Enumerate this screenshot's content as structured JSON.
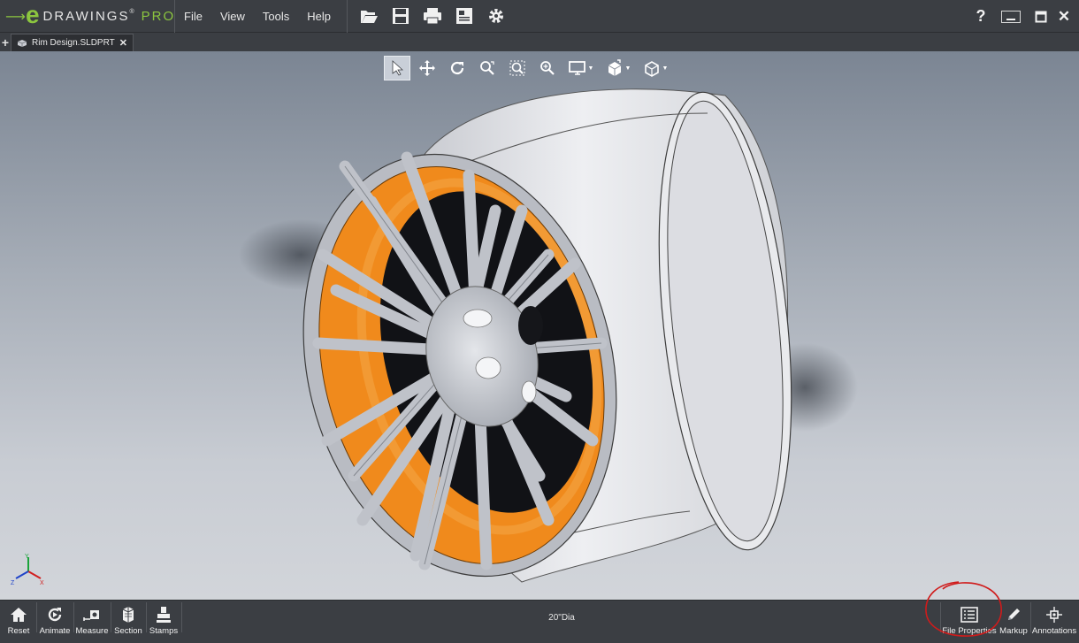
{
  "app": {
    "logo": {
      "e_letter": "e",
      "name": "DRAWINGS",
      "trademark": "®",
      "edition": "PRO"
    },
    "menu": [
      "File",
      "View",
      "Tools",
      "Help"
    ],
    "quick_access_icons": [
      "open-icon",
      "save-icon",
      "print-icon",
      "publish-icon",
      "settings-icon"
    ],
    "window_controls": {
      "help": "?",
      "close": "✕"
    },
    "accent_color": "#8cc63f"
  },
  "tabs": {
    "add_label": "+",
    "items": [
      {
        "label": "Rim Design.SLDPRT",
        "close": "✕"
      }
    ]
  },
  "view_toolbar": {
    "tools": [
      "select-icon",
      "pan-icon",
      "rotate-icon",
      "zoom-to-fit-icon",
      "zoom-to-area-icon",
      "zoom-icon",
      "display-style-icon",
      "view-orientation-icon",
      "standard-views-icon"
    ],
    "dropdown_arrow": "▼"
  },
  "viewport": {
    "model_colors": {
      "rim_body": "#dcdde2",
      "inner_barrel": "#f08a1c",
      "spokes": "#c2c5cc"
    },
    "triad_axes": {
      "x": "X",
      "y": "Y",
      "z": "Z"
    }
  },
  "bottom_bar": {
    "left_buttons": [
      {
        "label": "Reset",
        "icon": "home-icon"
      },
      {
        "label": "Animate",
        "icon": "animate-icon"
      },
      {
        "label": "Measure",
        "icon": "measure-icon"
      },
      {
        "label": "Section",
        "icon": "section-icon"
      },
      {
        "label": "Stamps",
        "icon": "stamps-icon"
      }
    ],
    "status_text": "20\"Dia",
    "right_buttons": [
      {
        "label": "File Properties",
        "icon": "file-properties-icon"
      },
      {
        "label": "Markup",
        "icon": "pencil-icon"
      },
      {
        "label": "Annotations",
        "icon": "annotations-icon"
      }
    ],
    "highlight_circle_color": "#d01b1b"
  }
}
